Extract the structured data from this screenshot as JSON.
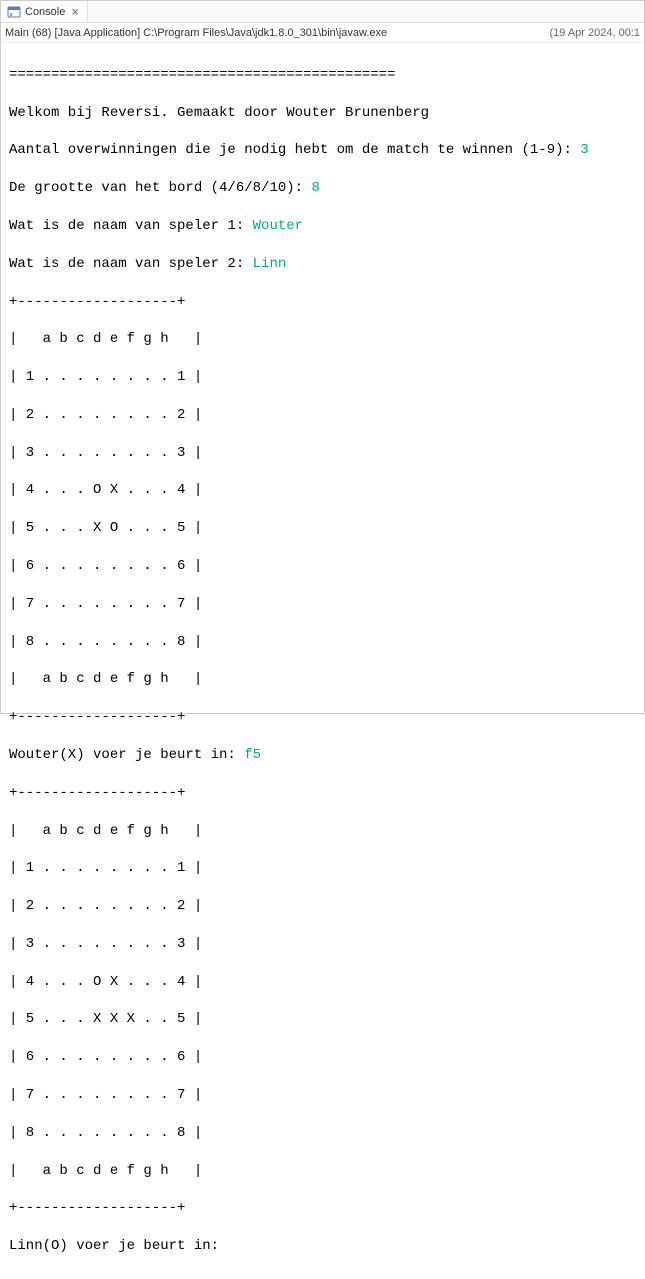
{
  "tab": {
    "title": "Console",
    "icon_name": "console-icon"
  },
  "info_bar": {
    "left": "Main (68) [Java Application] C:\\Program Files\\Java\\jdk1.8.0_301\\bin\\javaw.exe",
    "right": "(19 Apr 2024, 00:1"
  },
  "console": {
    "separator": "==============================================",
    "welcome": "Welkom bij Reversi. Gemaakt door Wouter Brunenberg",
    "q1_prompt": "Aantal overwinningen die je nodig hebt om de match te winnen (1-9): ",
    "q1_answer": "3",
    "q2_prompt": "De grootte van het bord (4/6/8/10): ",
    "q2_answer": "8",
    "q3_prompt": "Wat is de naam van speler 1: ",
    "q3_answer": "Wouter",
    "q4_prompt": "Wat is de naam van speler 2: ",
    "q4_answer": "Linn",
    "board1": {
      "top": "+-------------------+",
      "header": "|   a b c d e f g h   |",
      "row1": "| 1 . . . . . . . . 1 |",
      "row2": "| 2 . . . . . . . . 2 |",
      "row3": "| 3 . . . . . . . . 3 |",
      "row4": "| 4 . . . O X . . . 4 |",
      "row5": "| 5 . . . X O . . . 5 |",
      "row6": "| 6 . . . . . . . . 6 |",
      "row7": "| 7 . . . . . . . . 7 |",
      "row8": "| 8 . . . . . . . . 8 |",
      "footer": "|   a b c d e f g h   |",
      "bottom": "+-------------------+"
    },
    "turn1_prompt": "Wouter(X) voer je beurt in: ",
    "turn1_answer": "f5",
    "board2": {
      "top": "+-------------------+",
      "header": "|   a b c d e f g h   |",
      "row1": "| 1 . . . . . . . . 1 |",
      "row2": "| 2 . . . . . . . . 2 |",
      "row3": "| 3 . . . . . . . . 3 |",
      "row4": "| 4 . . . O X . . . 4 |",
      "row5": "| 5 . . . X X X . . 5 |",
      "row6": "| 6 . . . . . . . . 6 |",
      "row7": "| 7 . . . . . . . . 7 |",
      "row8": "| 8 . . . . . . . . 8 |",
      "footer": "|   a b c d e f g h   |",
      "bottom": "+-------------------+"
    },
    "turn2_prompt": "Linn(O) voer je beurt in:"
  }
}
